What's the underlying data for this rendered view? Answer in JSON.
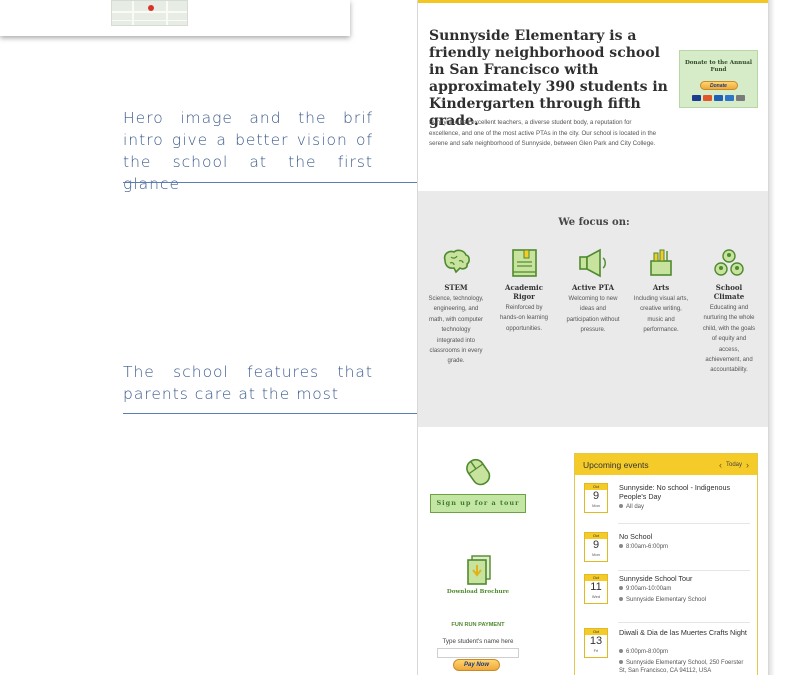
{
  "annotations": {
    "hero_note": "Hero image and the brif intro give a better vision of the school at the first glance",
    "features_note": "The school features that parents care at the most"
  },
  "intro": {
    "title": "Sunnyside Elementary is a friendly neighborhood school in San Francisco with approximately 390 students in Kindergarten through fifth grade.",
    "body": "Sunnyside has excellent teachers, a diverse student body, a reputation for excellence, and one of the most active PTAs in the city. Our school is located in the serene and safe neighborhood of Sunnyside, between Glen Park and City College."
  },
  "donate": {
    "title": "Donate to the Annual Fund",
    "button": "Donate"
  },
  "focus": {
    "title": "We focus on:",
    "features": [
      {
        "name": "STEM",
        "desc": "Science, technology, engineering, and math, with computer technology integrated into classrooms in every grade.",
        "icon": "brain-icon"
      },
      {
        "name": "Academic Rigor",
        "desc": "Reinforced by hands-on learning opportunities.",
        "icon": "book-icon"
      },
      {
        "name": "Active PTA",
        "desc": "Welcoming to new ideas and participation without pressure.",
        "icon": "megaphone-icon"
      },
      {
        "name": "Arts",
        "desc": "Including visual arts, creative writing, music and performance.",
        "icon": "art-supplies-icon"
      },
      {
        "name": "School Climate",
        "desc": "Educating and nurturing the whole child, with the goals of equity and access, achievement, and accountability.",
        "icon": "people-icon"
      }
    ]
  },
  "actions": {
    "tour_button": "Sign up for a tour",
    "brochure_label": "Download Brochure",
    "fun_run_title": "FUN RUN PAYMENT",
    "fun_run_label": "Type student's name here",
    "pay_button": "Pay Now"
  },
  "events": {
    "title": "Upcoming events",
    "today_label": "Today",
    "items": [
      {
        "month": "Oct",
        "day": "9",
        "dow": "Mon",
        "title": "Sunnyside: No school - Indigenous People's Day",
        "time": "All day",
        "location": ""
      },
      {
        "month": "Oct",
        "day": "9",
        "dow": "Mon",
        "title": "No School",
        "time": "8:00am-6:00pm",
        "location": ""
      },
      {
        "month": "Oct",
        "day": "11",
        "dow": "Wed",
        "title": "Sunnyside School Tour",
        "time": "9:00am-10:00am",
        "location": "Sunnyside Elementary School"
      },
      {
        "month": "Oct",
        "day": "13",
        "dow": "Fri",
        "title": "Diwali & Dia de las Muertes Crafts Night",
        "time": "6:00pm-8:00pm",
        "location": "Sunnyside Elementary School, 250 Foerster St, San Francisco, CA 94112, USA"
      }
    ]
  },
  "colors": {
    "accent_yellow": "#f5cb2a",
    "accent_green": "#6aa244",
    "annotation_blue": "#3b5a8c",
    "focus_bg": "#eaeaea"
  }
}
